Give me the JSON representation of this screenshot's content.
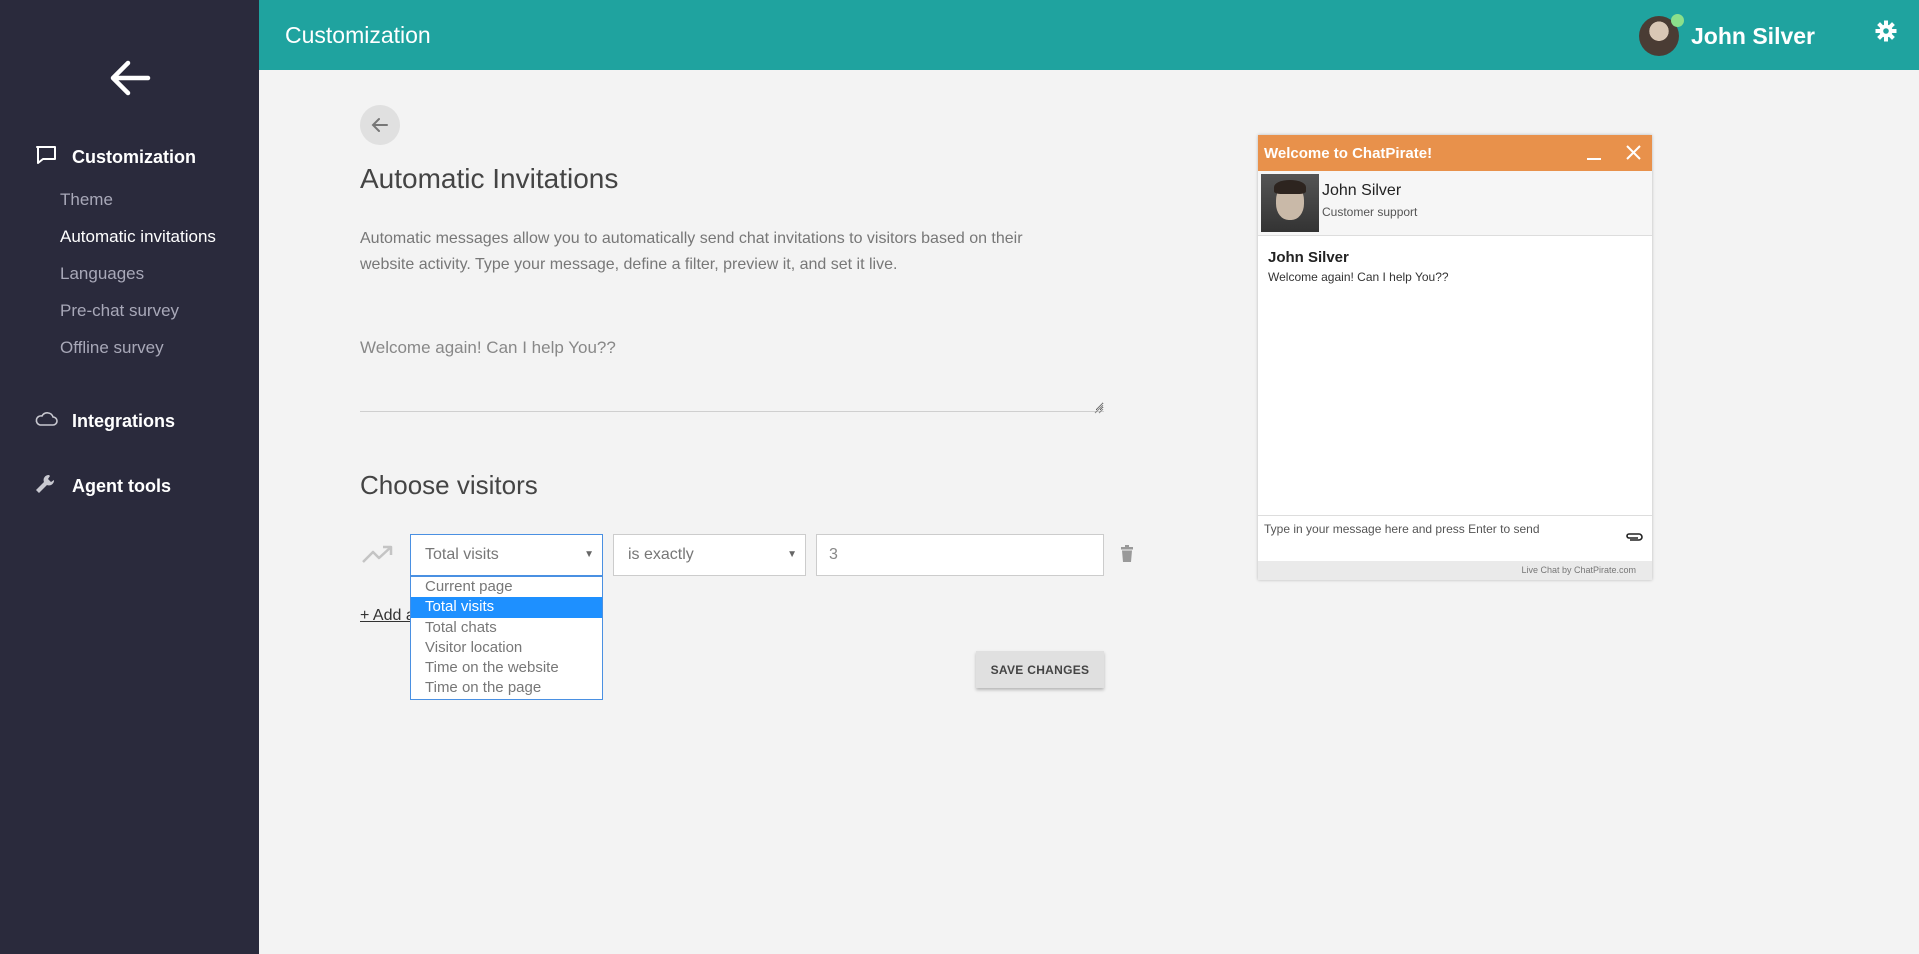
{
  "sidebar": {
    "sections": [
      {
        "label": "Customization",
        "icon": "chat-bubble-icon"
      },
      {
        "label": "Integrations",
        "icon": "cloud-icon"
      },
      {
        "label": "Agent tools",
        "icon": "wrench-icon"
      }
    ],
    "sub_items": [
      "Theme",
      "Automatic invitations",
      "Languages",
      "Pre-chat survey",
      "Offline survey"
    ],
    "active_sub": "Automatic invitations"
  },
  "header": {
    "title": "Customization",
    "user_name": "John Silver",
    "status_color": "#8be08b",
    "bg_color": "#1fa39f"
  },
  "main": {
    "heading": "Automatic Invitations",
    "description": "Automatic messages allow you to automatically send chat invitations to visitors based on their website activity. Type your message, define a filter, preview it, and set it live.",
    "message_value": "Welcome again! Can I help You??",
    "choose_heading": "Choose visitors",
    "filter": {
      "field_value": "Total visits",
      "operator_value": "is exactly",
      "value": "3",
      "field_options": [
        "Current page",
        "Total visits",
        "Total chats",
        "Visitor location",
        "Time on the website",
        "Time on the page"
      ]
    },
    "add_link": "+ Add a",
    "save_label": "SAVE CHANGES"
  },
  "chat": {
    "header_title": "Welcome to ChatPirate!",
    "header_color": "#e8914b",
    "agent_name": "John Silver",
    "agent_role": "Customer support",
    "message_author": "John Silver",
    "message_text": "Welcome again! Can I help You??",
    "input_placeholder": "Type in your message here and press Enter to send",
    "footer": "Live Chat by ChatPirate.com"
  }
}
